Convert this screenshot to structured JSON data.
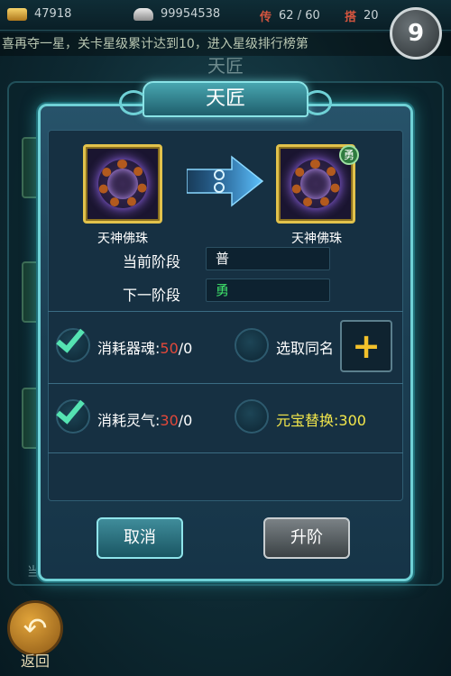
{
  "topbar": {
    "gold": "47918",
    "ingot": "99954538",
    "tag_left": "传",
    "progress": "62 / 60",
    "tag_right": "搭",
    "extra": "20"
  },
  "marquee": "喜再夺一星，关卡星级累计达到10，进入星级排行榜第",
  "background": {
    "title": "天匠",
    "footer_text": "当前阶段",
    "back_label": "返回"
  },
  "corner_button": {
    "label": "9"
  },
  "dialog": {
    "title": "天匠",
    "source_item": {
      "name": "天神佛珠"
    },
    "target_item": {
      "name": "天神佛珠",
      "badge": "勇"
    },
    "current_stage_label": "当前阶段",
    "current_stage_value": "普",
    "next_stage_label": "下一阶段",
    "next_stage_value": "勇",
    "cost1": {
      "label": "消耗器魂:",
      "have": "50",
      "need": "/0",
      "checked": true
    },
    "cost2": {
      "label": "消耗灵气:",
      "have": "30",
      "need": "/0",
      "checked": true
    },
    "option1": {
      "label": "选取同名",
      "checked": false
    },
    "option2": {
      "label": "元宝替换:300",
      "checked": false
    },
    "add_button": "+",
    "cancel": "取消",
    "upgrade": "升阶"
  },
  "colors": {
    "accent": "#6fd1d6",
    "check": "#55e3b2",
    "red_value": "#e2483a",
    "yellow_text": "#f3e74b",
    "next_stage_green": "#3fe26a"
  },
  "icons": {
    "corner": "butterfly-icon",
    "back": "return-arrow-icon",
    "arrow": "right-arrow-icon",
    "add": "plus-icon"
  }
}
